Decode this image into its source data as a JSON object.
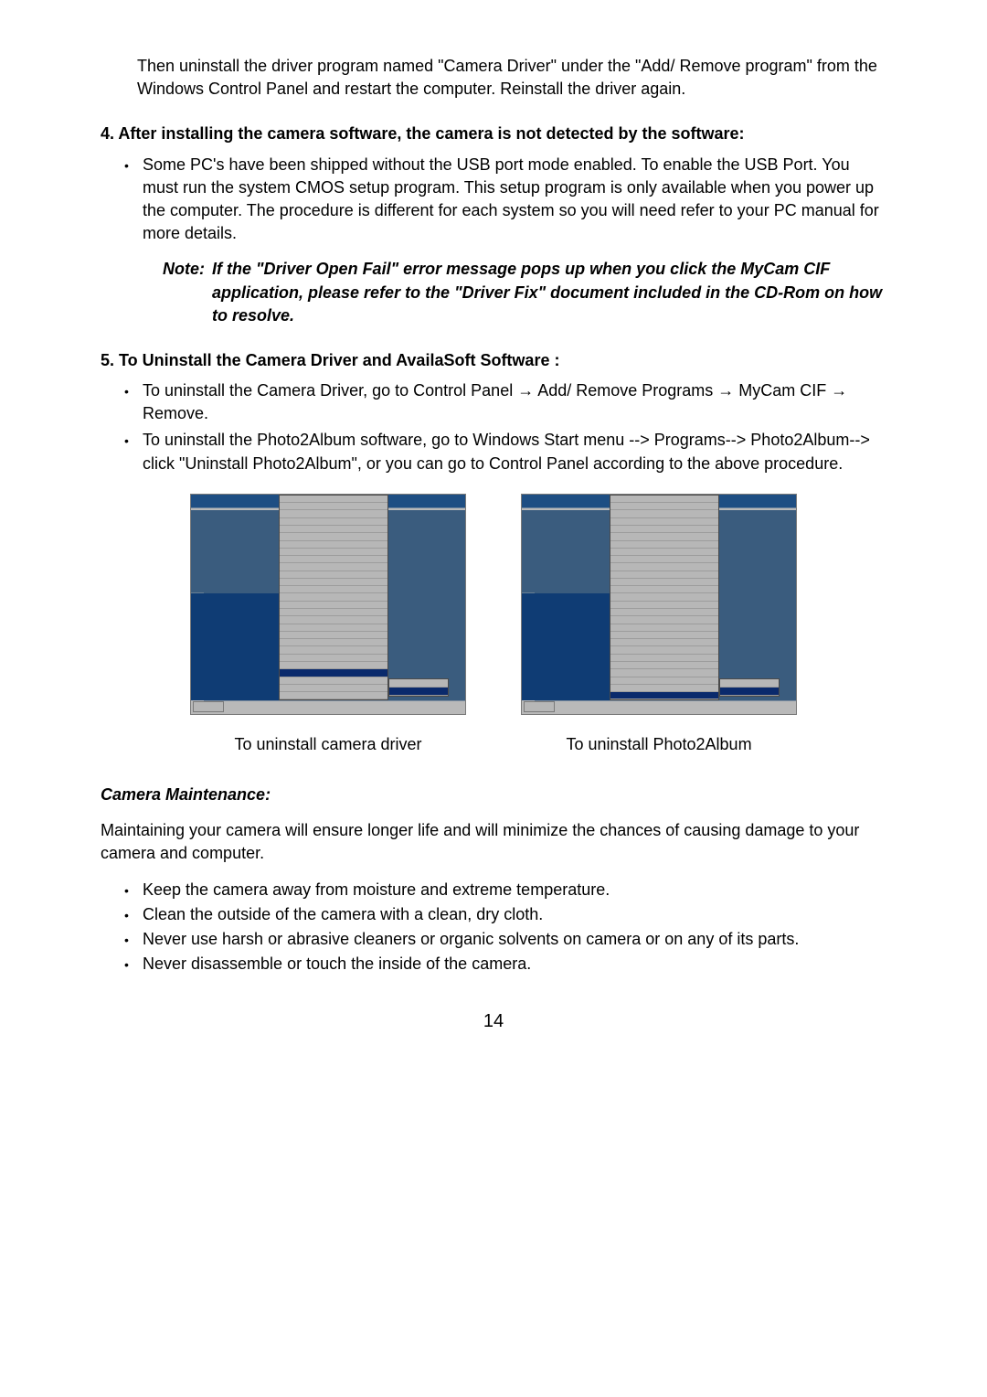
{
  "intro": {
    "text": "Then uninstall the driver program named \"Camera Driver\" under the \"Add/ Remove program\" from the Windows Control Panel and restart the computer. Reinstall the driver again."
  },
  "section4": {
    "title": "4.  After installing the camera software, the camera is not detected by the software:",
    "bullet": "Some PC's have been shipped without the USB port mode enabled. To enable the USB Port.  You must run the system CMOS setup program. This setup program is only available when you power up the computer. The procedure is different for each system so you will need refer to your PC manual for more details.",
    "note_label": "Note:",
    "note_text": "If the \"Driver Open Fail\" error message pops up when you click the MyCam CIF application, please refer to the \"Driver Fix\" document included in the CD-Rom on how to resolve."
  },
  "section5": {
    "title": "5. To Uninstall the Camera Driver and AvailaSoft  Software :",
    "b1": "To uninstall the Camera Driver, go to Control Panel → Add/ Remove Programs → MyCam CIF → Remove.",
    "b2": "To uninstall the Photo2Album software, go to Windows Start menu --> Programs--> Photo2Album--> click \"Uninstall Photo2Album\", or you can go to Control Panel according to the above procedure."
  },
  "figures": {
    "caption1": "To uninstall camera driver",
    "caption2": "To uninstall Photo2Album"
  },
  "maintenance": {
    "title": "Camera Maintenance:",
    "intro": "Maintaining your camera will ensure longer life and will minimize the chances of causing damage to your camera and computer.",
    "b1": "Keep the camera away from moisture and extreme temperature.",
    "b2": "Clean the outside of the camera with a clean, dry cloth.",
    "b3": "Never use harsh or abrasive cleaners or organic solvents on camera or on any of its parts.",
    "b4": "Never disassemble or touch the inside of the camera."
  },
  "pagenum": "14"
}
